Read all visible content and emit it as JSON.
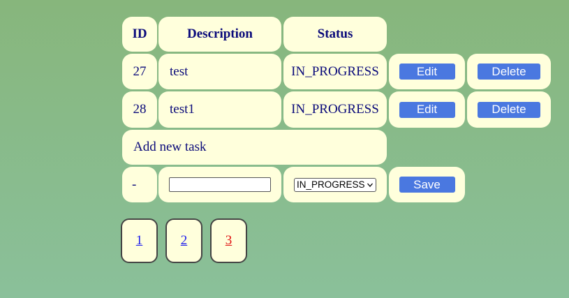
{
  "table": {
    "headers": {
      "id": "ID",
      "description": "Description",
      "status": "Status"
    },
    "rows": [
      {
        "id": "27",
        "description": "test",
        "status": "IN_PROGRESS",
        "edit_label": "Edit",
        "delete_label": "Delete"
      },
      {
        "id": "28",
        "description": "test1",
        "status": "IN_PROGRESS",
        "edit_label": "Edit",
        "delete_label": "Delete"
      }
    ]
  },
  "add_task": {
    "title": "Add new task",
    "id_placeholder": "-",
    "description_value": "",
    "status_selected": "IN_PROGRESS",
    "save_label": "Save"
  },
  "pagination": {
    "pages": [
      {
        "label": "1",
        "color": "#1a1aee"
      },
      {
        "label": "2",
        "color": "#1a1aee"
      },
      {
        "label": "3",
        "color": "#e01010"
      }
    ],
    "active_page": "3"
  },
  "colors": {
    "cell_background": "#ffffdc",
    "button_blue": "#4a78e0",
    "text_navy": "#0a0a7a"
  },
  "icons": {
    "dropdown": "chevron-down-icon"
  }
}
